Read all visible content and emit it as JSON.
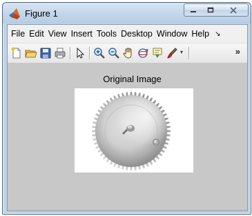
{
  "window": {
    "title": "Figure 1",
    "controls": {
      "minimize_icon": "minimize-icon",
      "maximize_icon": "maximize-icon",
      "close_icon": "close-icon"
    }
  },
  "menubar": {
    "items": [
      "File",
      "Edit",
      "View",
      "Insert",
      "Tools",
      "Desktop",
      "Window",
      "Help"
    ],
    "overflow_glyph": "↘"
  },
  "toolbar": {
    "icons": [
      "new-figure-icon",
      "open-file-icon",
      "save-icon",
      "print-icon",
      "pointer-icon",
      "zoom-in-icon",
      "zoom-out-icon",
      "pan-icon",
      "rotate-3d-icon",
      "data-cursor-icon",
      "brush-icon"
    ],
    "overflow_glyph": "»"
  },
  "axes": {
    "title": "Original Image",
    "image_subject": "grayscale photo of a spur gear"
  },
  "colors": {
    "titlebar": "#c3d6ea",
    "figure_background": "#c8c8c8",
    "menubar": "#f0f0f0"
  }
}
